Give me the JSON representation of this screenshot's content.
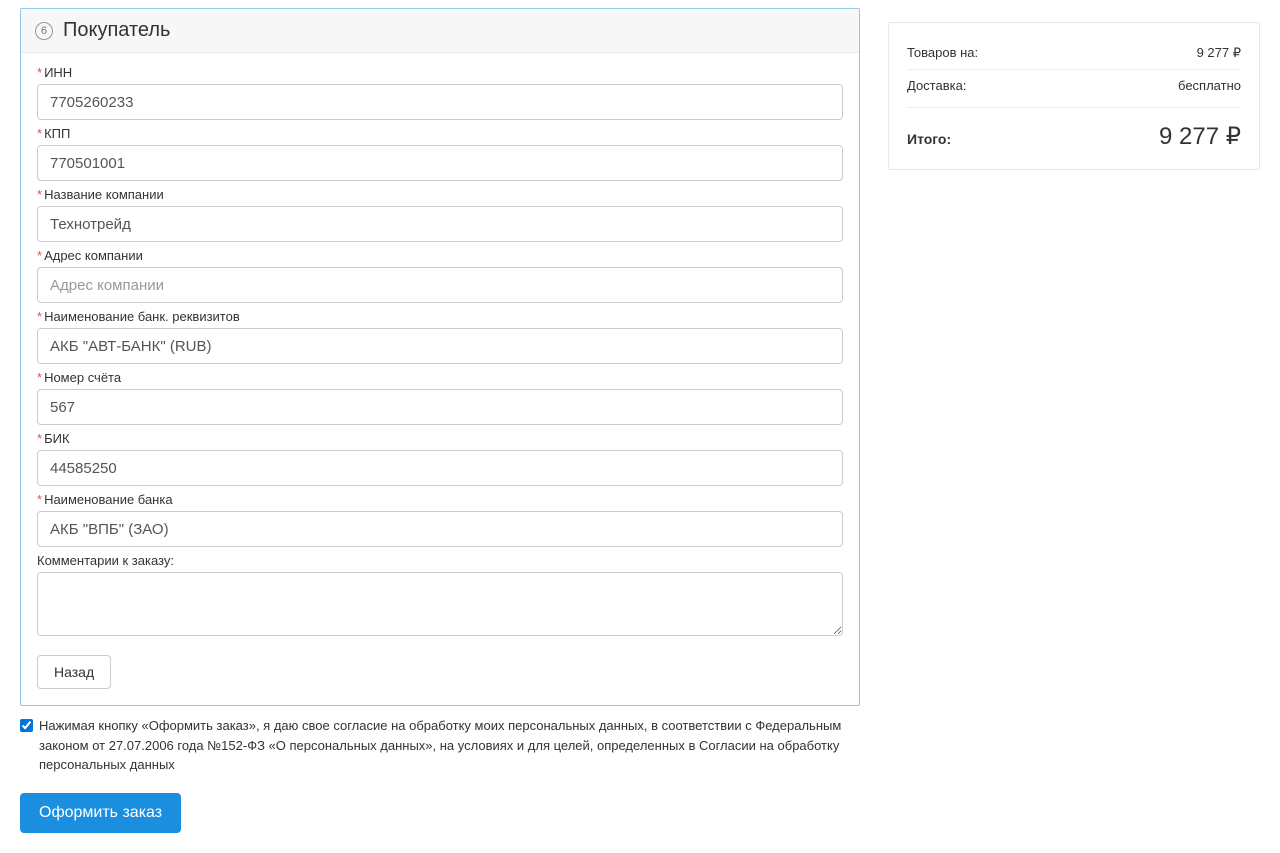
{
  "panel": {
    "step": "6",
    "title": "Покупатель"
  },
  "form": {
    "inn": {
      "label": "ИНН",
      "value": "7705260233"
    },
    "kpp": {
      "label": "КПП",
      "value": "770501001"
    },
    "company_name": {
      "label": "Название компании",
      "value": "Технотрейд"
    },
    "company_address": {
      "label": "Адрес компании",
      "value": "",
      "placeholder": "Адрес компании"
    },
    "bank_req_name": {
      "label": "Наименование банк. реквизитов",
      "value": "АКБ \"АВТ-БАНК\" (RUB)"
    },
    "account_number": {
      "label": "Номер счёта",
      "value": "567"
    },
    "bik": {
      "label": "БИК",
      "value": "44585250"
    },
    "bank_name": {
      "label": "Наименование банка",
      "value": "АКБ \"ВПБ\" (ЗАО)"
    },
    "comment": {
      "label": "Комментарии к заказу:",
      "value": ""
    }
  },
  "buttons": {
    "back": "Назад",
    "submit": "Оформить заказ"
  },
  "agree": {
    "checked": true,
    "text": "Нажимая кнопку «Оформить заказ», я даю свое согласие на обработку моих персональных данных, в соответствии с Федеральным законом от 27.07.2006 года №152-ФЗ «О персональных данных», на условиях и для целей, определенных в Согласии на обработку персональных данных"
  },
  "summary": {
    "goods": {
      "label": "Товаров на:",
      "value": "9 277 ₽"
    },
    "delivery": {
      "label": "Доставка:",
      "value": "бесплатно"
    },
    "total": {
      "label": "Итого:",
      "value": "9 277 ₽"
    }
  }
}
